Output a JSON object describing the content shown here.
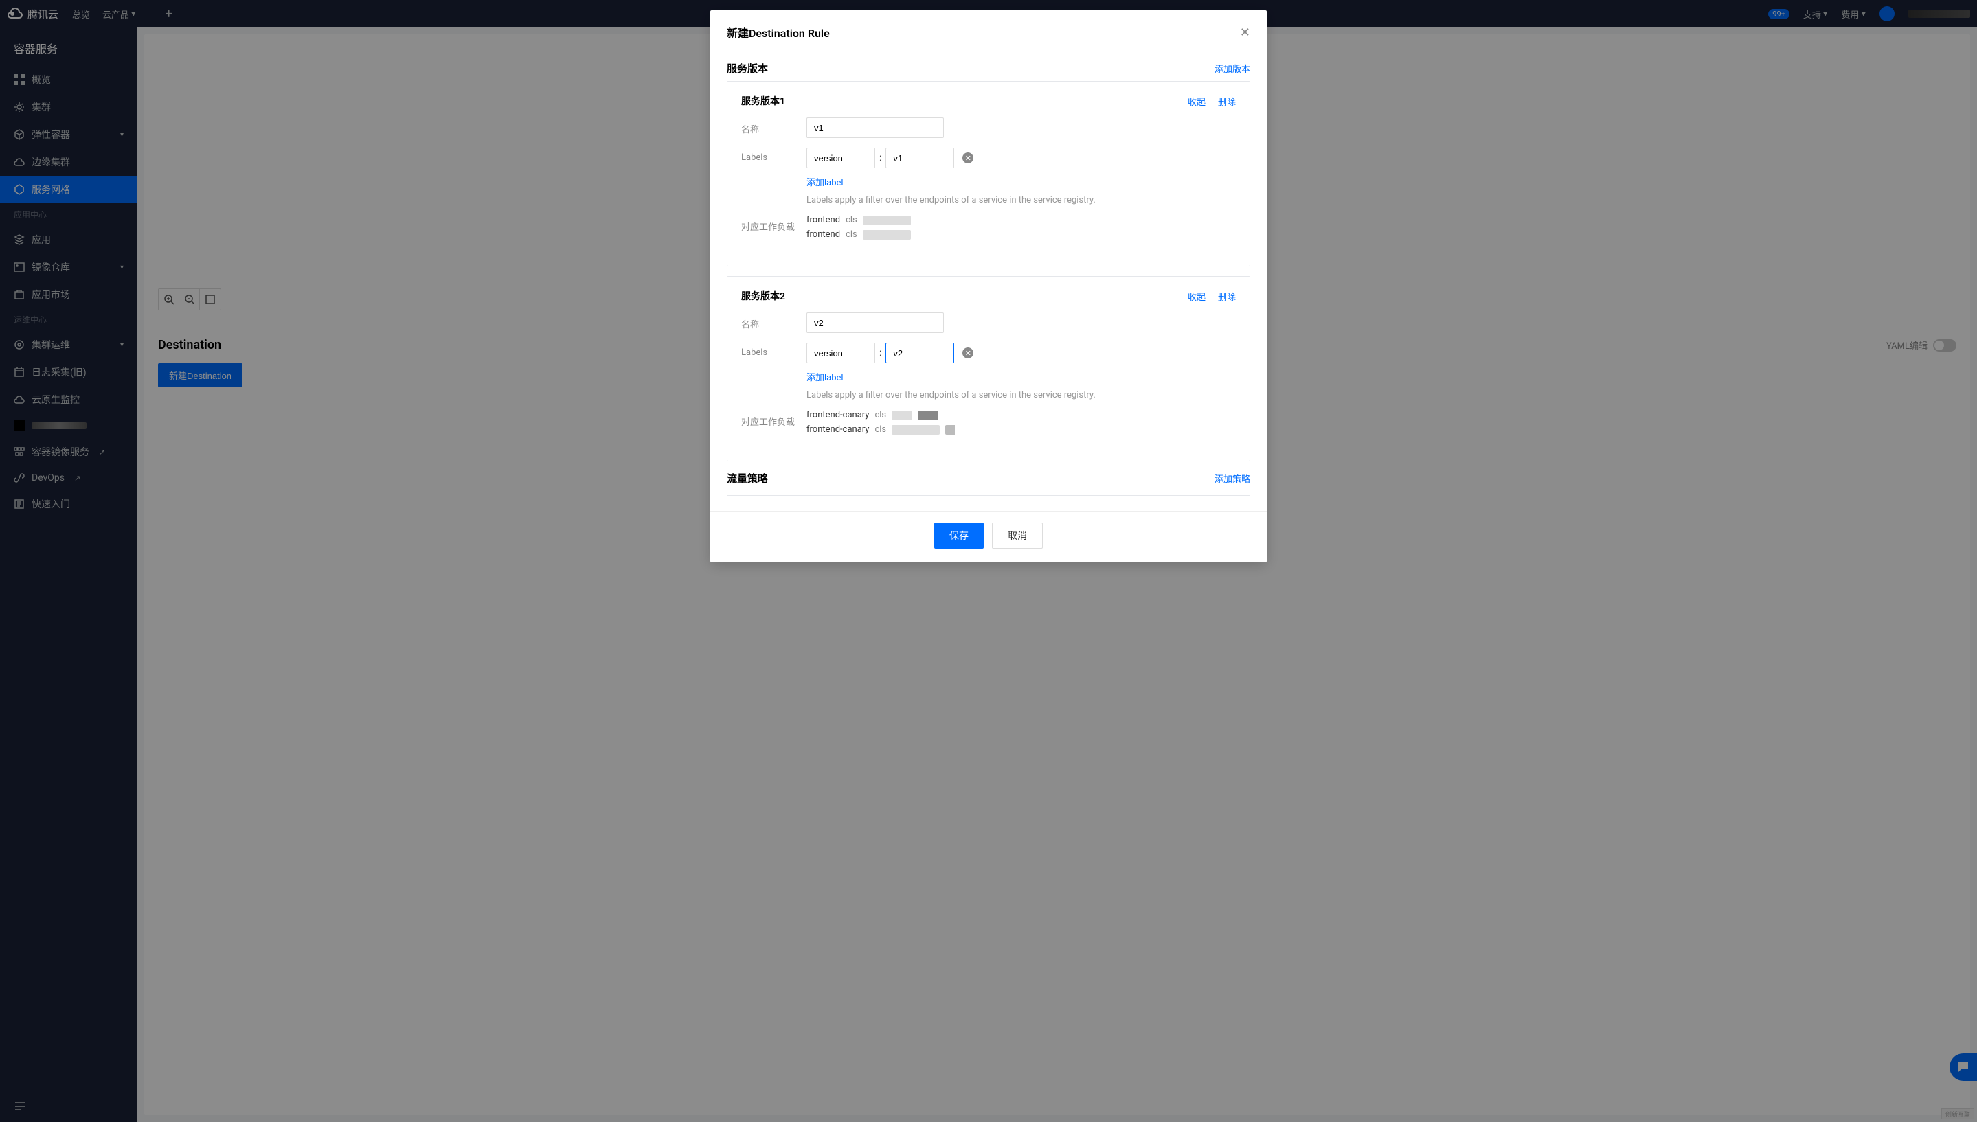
{
  "header": {
    "brand": "腾讯云",
    "nav": {
      "overview": "总览",
      "products": "云产品"
    },
    "badge": "99+",
    "right": {
      "support": "支持",
      "billing": "费用"
    }
  },
  "sidebar": {
    "title": "容器服务",
    "items": {
      "overview": "概览",
      "cluster": "集群",
      "elastic": "弹性容器",
      "edge": "边缘集群",
      "mesh": "服务网格"
    },
    "section_app": "应用中心",
    "app_items": {
      "app": "应用",
      "registry": "镜像仓库",
      "market": "应用市场"
    },
    "section_ops": "运维中心",
    "ops_items": {
      "cluster_ops": "集群运维",
      "log_old": "日志采集(旧)",
      "cloud_native_mon": "云原生监控"
    },
    "ext_items": {
      "tcr": "容器镜像服务",
      "devops": "DevOps",
      "quickstart": "快速入门"
    }
  },
  "main": {
    "section_title": "Destination",
    "new_button": "新建Destination",
    "yaml_toggle": "YAML编辑"
  },
  "modal": {
    "title": "新建Destination Rule",
    "section_service_version": "服务版本",
    "add_version": "添加版本",
    "section_traffic_policy": "流量策略",
    "add_policy": "添加策略",
    "actions": {
      "collapse": "收起",
      "delete": "删除"
    },
    "labels": {
      "name": "名称",
      "labels": "Labels",
      "workload": "对应工作负载"
    },
    "add_label": "添加label",
    "hint": "Labels apply a filter over the endpoints of a service in the service registry.",
    "versions": [
      {
        "card_title": "服务版本1",
        "name": "v1",
        "label_key": "version",
        "label_value": "v1",
        "workloads": [
          {
            "name": "frontend",
            "cls": "cls"
          },
          {
            "name": "frontend",
            "cls": "cls"
          }
        ]
      },
      {
        "card_title": "服务版本2",
        "name": "v2",
        "label_key": "version",
        "label_value": "v2",
        "workloads": [
          {
            "name": "frontend-canary",
            "cls": "cls"
          },
          {
            "name": "frontend-canary",
            "cls": "cls"
          }
        ]
      }
    ],
    "save": "保存",
    "cancel": "取消"
  },
  "watermark": "创新互联"
}
